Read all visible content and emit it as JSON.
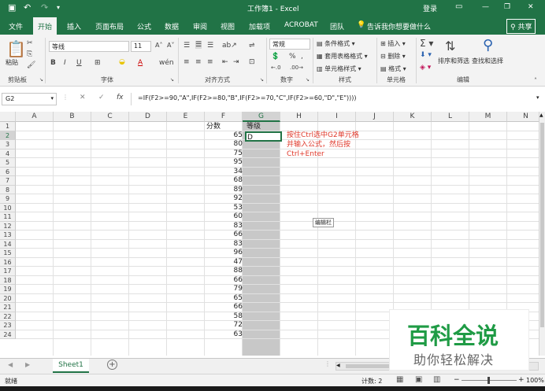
{
  "window": {
    "title": "工作簿1 - Excel",
    "login": "登录",
    "share": "共享"
  },
  "tabs": [
    "文件",
    "开始",
    "插入",
    "页面布局",
    "公式",
    "数据",
    "审阅",
    "视图",
    "加载项",
    "ACROBAT",
    "团队"
  ],
  "tell_me": "告诉我你想要做什么",
  "ribbon": {
    "paste": "粘贴",
    "font_name": "等线",
    "font_size": "11",
    "number_format": "常规",
    "conditional_formatting": "条件格式",
    "format_as_table": "套用表格格式",
    "cell_styles": "单元格样式",
    "insert": "插入",
    "delete": "删除",
    "format": "格式",
    "sort_filter": "排序和筛选",
    "find_select": "查找和选择",
    "groups": {
      "clipboard": "剪贴板",
      "font": "字体",
      "alignment": "对齐方式",
      "number": "数字",
      "styles": "样式",
      "cells": "单元格",
      "editing": "编辑"
    }
  },
  "formula_bar": {
    "name_box": "G2",
    "cancel": "✕",
    "enter": "✓",
    "fx": "fx",
    "formula": "=IF(F2>=90,\"A\",IF(F2>=80,\"B\",IF(F2>=70,\"C\",IF(F2>=60,\"D\",\"E\"))))"
  },
  "sheet": {
    "columns": [
      "A",
      "B",
      "C",
      "D",
      "E",
      "F",
      "G",
      "H",
      "I",
      "J",
      "K",
      "L",
      "M",
      "N"
    ],
    "rows": [
      "1",
      "2",
      "3",
      "4",
      "5",
      "6",
      "7",
      "8",
      "9",
      "10",
      "11",
      "12",
      "13",
      "14",
      "15",
      "16",
      "17",
      "18",
      "19",
      "20",
      "21",
      "22",
      "23",
      "24"
    ],
    "f_header": "分数",
    "g_header": "等级",
    "g2_value": "D",
    "scores": [
      "65",
      "80",
      "75",
      "95",
      "34",
      "68",
      "89",
      "92",
      "53",
      "60",
      "83",
      "66",
      "83",
      "96",
      "47",
      "88",
      "66",
      "79",
      "65",
      "66",
      "58",
      "72",
      "63"
    ],
    "annotation": [
      "按住Ctrl选中G2单元格",
      "并输入公式，然后按",
      "Ctrl+Enter"
    ],
    "tooltip": "编辑栏"
  },
  "sheet_tabs": {
    "active": "Sheet1",
    "add": "+"
  },
  "status": {
    "mode": "就绪",
    "count": "计数: 2",
    "zoom": "100%"
  },
  "watermark": {
    "title": "百科全说",
    "subtitle": "助你轻松解决"
  },
  "colors": {
    "excel_green": "#217346",
    "annotation": "#e0392b",
    "selected_column": "#c8c8c8",
    "watermark_green": "#1f9b45"
  }
}
